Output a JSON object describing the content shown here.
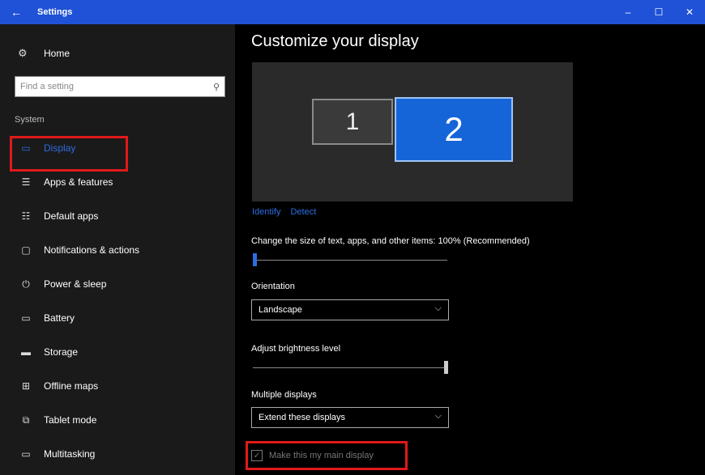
{
  "window": {
    "title": "Settings",
    "back_icon": "←",
    "minimize_icon": "–",
    "maximize_icon": "☐",
    "close_icon": "✕"
  },
  "sidebar": {
    "home_label": "Home",
    "search_placeholder": "Find a setting",
    "section_label": "System",
    "items": [
      {
        "label": "Display",
        "icon": "monitor-icon",
        "active": true
      },
      {
        "label": "Apps & features",
        "icon": "list-icon",
        "active": false
      },
      {
        "label": "Default apps",
        "icon": "default-apps-icon",
        "active": false
      },
      {
        "label": "Notifications & actions",
        "icon": "notification-icon",
        "active": false
      },
      {
        "label": "Power & sleep",
        "icon": "power-icon",
        "active": false
      },
      {
        "label": "Battery",
        "icon": "battery-icon",
        "active": false
      },
      {
        "label": "Storage",
        "icon": "storage-icon",
        "active": false
      },
      {
        "label": "Offline maps",
        "icon": "map-icon",
        "active": false
      },
      {
        "label": "Tablet mode",
        "icon": "tablet-icon",
        "active": false
      },
      {
        "label": "Multitasking",
        "icon": "multitasking-icon",
        "active": false
      }
    ]
  },
  "main": {
    "title": "Customize your display",
    "monitor_1": "1",
    "monitor_2": "2",
    "identify_link": "Identify",
    "detect_link": "Detect",
    "scale_label": "Change the size of text, apps, and other items: 100% (Recommended)",
    "scale_value_percent": 0,
    "orientation_label": "Orientation",
    "orientation_value": "Landscape",
    "brightness_label": "Adjust brightness level",
    "brightness_value_percent": 100,
    "multiple_displays_label": "Multiple displays",
    "multiple_displays_value": "Extend these displays",
    "main_display_label": "Make this my main display",
    "main_display_checked": true
  },
  "colors": {
    "accent": "#2d6de0",
    "titlebar": "#1f52d6",
    "highlight": "#e01919"
  }
}
